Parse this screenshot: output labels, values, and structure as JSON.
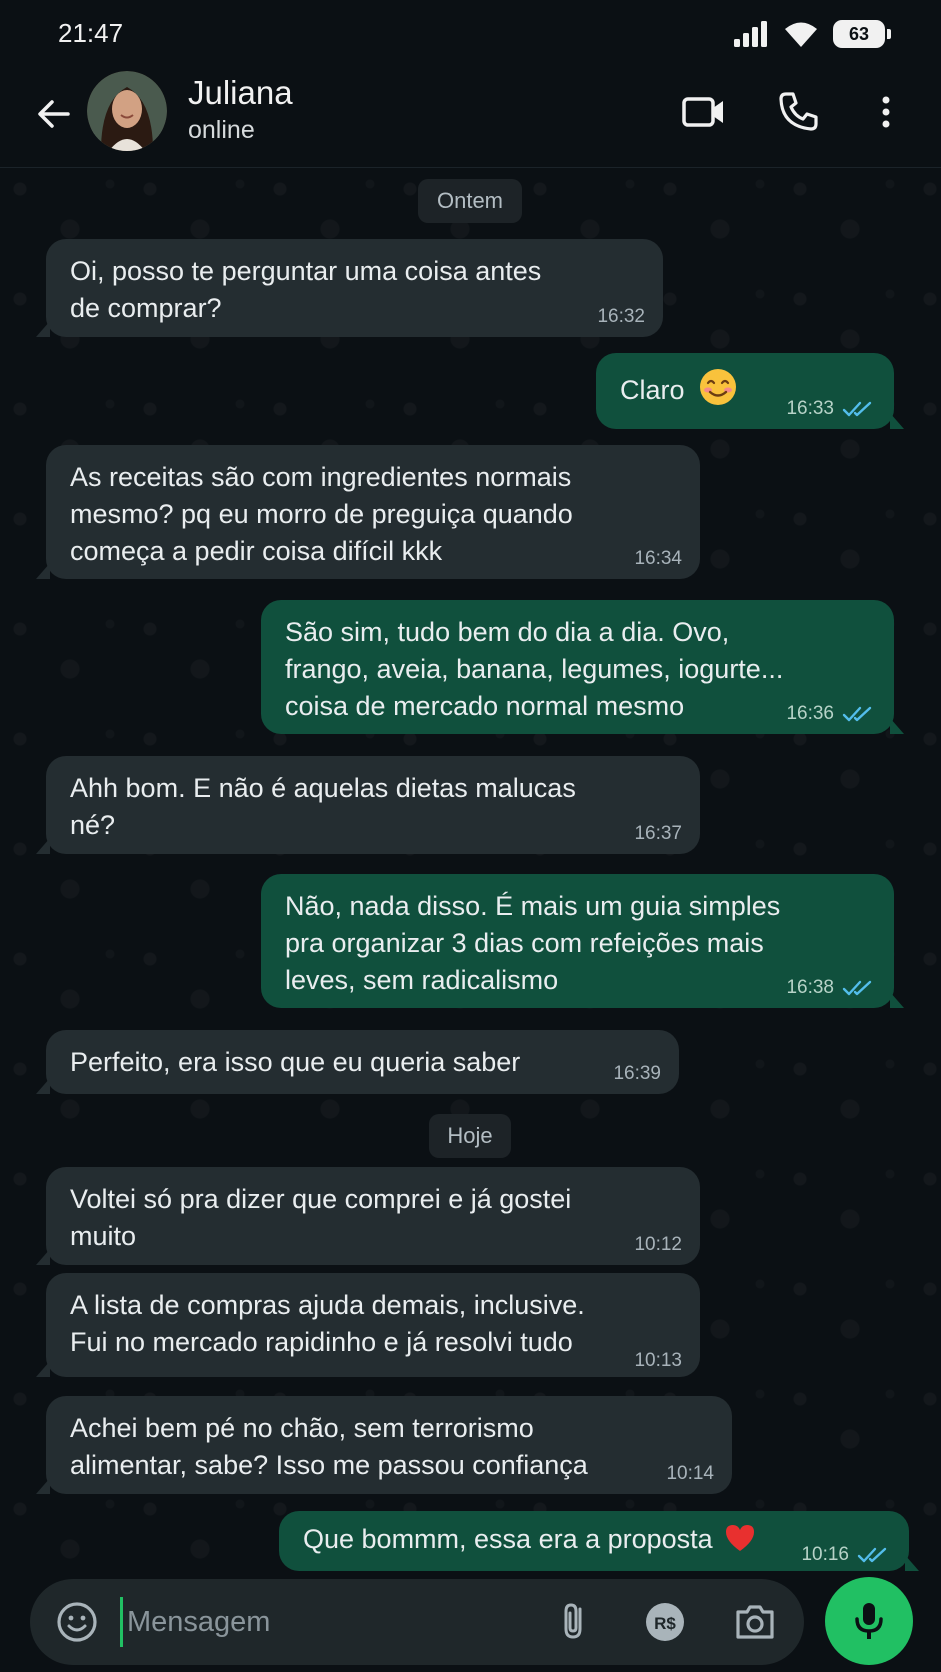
{
  "status_bar": {
    "time": "21:47",
    "battery": "63"
  },
  "header": {
    "contact_name": "Juliana",
    "contact_status": "online"
  },
  "day_labels": {
    "yesterday": "Ontem",
    "today": "Hoje"
  },
  "messages": [
    {
      "direction": "in",
      "text": "Oi, posso te perguntar uma coisa antes\nde comprar?",
      "time": "16:32"
    },
    {
      "direction": "out",
      "text": "Claro",
      "emoji": "smiling-face-emoji",
      "time": "16:33",
      "status": "read"
    },
    {
      "direction": "in",
      "text": "As receitas são com ingredientes normais\nmesmo? pq eu morro de preguiça quando\ncomeça a pedir coisa difícil kkk",
      "time": "16:34"
    },
    {
      "direction": "out",
      "text": "São sim, tudo bem do dia a dia. Ovo,\nfrango, aveia, banana, legumes, iogurte...\ncoisa de mercado normal mesmo",
      "time": "16:36",
      "status": "read"
    },
    {
      "direction": "in",
      "text": "Ahh bom. E não é aquelas dietas malucas\nné?",
      "time": "16:37"
    },
    {
      "direction": "out",
      "text": "Não, nada disso. É mais um guia simples\npra organizar 3 dias com refeições mais\nleves, sem radicalismo",
      "time": "16:38",
      "status": "read"
    },
    {
      "direction": "in",
      "text": "Perfeito, era isso que eu queria saber",
      "time": "16:39"
    },
    {
      "direction": "in",
      "text": "Voltei só pra dizer que comprei e já gostei\nmuito",
      "time": "10:12"
    },
    {
      "direction": "in",
      "text": "A lista de compras ajuda demais, inclusive.\nFui no mercado rapidinho e já resolvi tudo",
      "time": "10:13"
    },
    {
      "direction": "in",
      "text": "Achei bem pé no chão, sem terrorismo\nalimentar, sabe? Isso me passou confiança",
      "time": "10:14"
    },
    {
      "direction": "out",
      "text": "Que bommm, essa era a proposta",
      "emoji": "red-heart-emoji",
      "time": "10:16",
      "status": "read"
    }
  ],
  "input": {
    "placeholder": "Mensagem"
  },
  "colors": {
    "background": "#0b1014",
    "incoming_bubble": "#242d31",
    "outgoing_bubble": "#10503d",
    "accent_green": "#21c063",
    "read_ticks": "#53bdeb"
  },
  "icons": [
    "back-arrow-icon",
    "video-call-icon",
    "phone-icon",
    "more-vertical-icon",
    "emoji-icon",
    "attach-icon",
    "payment-icon",
    "camera-icon",
    "mic-icon",
    "read-ticks-icon",
    "signal-icon",
    "wifi-icon",
    "battery-icon"
  ]
}
